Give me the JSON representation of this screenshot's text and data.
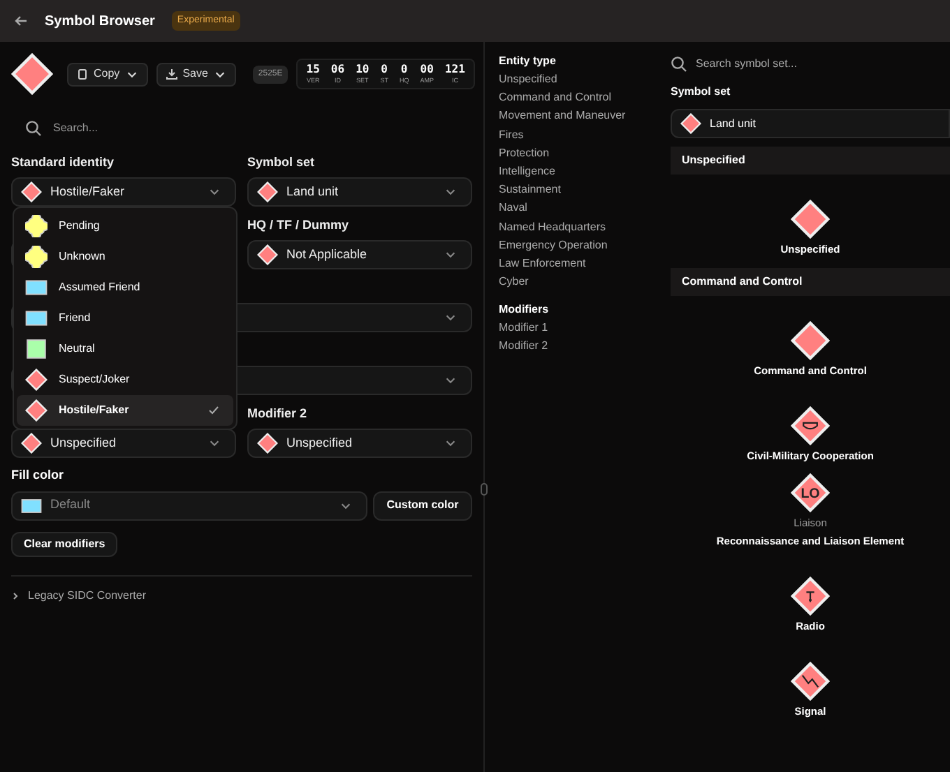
{
  "header": {
    "title": "Symbol Browser",
    "badge": "Experimental"
  },
  "toolbar": {
    "copy": "Copy",
    "save": "Save",
    "standard": "2525E",
    "code": [
      {
        "value": "15",
        "label": "VER"
      },
      {
        "value": "06",
        "label": "ID"
      },
      {
        "value": "10",
        "label": "SET"
      },
      {
        "value": "0",
        "label": "ST"
      },
      {
        "value": "0",
        "label": "HQ"
      },
      {
        "value": "00",
        "label": "AMP"
      },
      {
        "value": "121",
        "label": "IC"
      }
    ]
  },
  "search": {
    "placeholder": "Search..."
  },
  "form": [
    {
      "label": "Standard identity",
      "value": "Hostile/Faker"
    },
    {
      "label": "Symbol set",
      "value": "Land unit"
    },
    {
      "label": "HQ / TF / Dummy",
      "value": "Not Applicable"
    },
    {
      "value": "Unspecified"
    },
    {
      "label": "Modifier 2",
      "value": "Unspecified"
    }
  ],
  "fill_color": {
    "label": "Fill color",
    "value": "Default",
    "button": "Custom color"
  },
  "clear_button": "Clear modifiers",
  "legacy": {
    "label": "Legacy SIDC Converter",
    "expanded": false
  },
  "dropdown": [
    {
      "label": "Pending",
      "kind": "clover",
      "color": "#ffff80",
      "selected": false
    },
    {
      "label": "Unknown",
      "kind": "clover",
      "color": "#ffff80",
      "selected": false
    },
    {
      "label": "Assumed Friend",
      "kind": "rect",
      "color": "#80e0ff",
      "selected": false
    },
    {
      "label": "Friend",
      "kind": "rect",
      "color": "#80e0ff",
      "selected": false
    },
    {
      "label": "Neutral",
      "kind": "square",
      "color": "#aaffaa",
      "selected": false
    },
    {
      "label": "Suspect/Joker",
      "kind": "diamond",
      "color": "#ff8080",
      "selected": false
    },
    {
      "label": "Hostile/Faker",
      "kind": "diamond",
      "color": "#ff8080",
      "selected": true
    }
  ],
  "entity_types": {
    "heading": "Entity type",
    "items": [
      "Unspecified",
      "Command and Control",
      "Movement and Maneuver",
      "Fires",
      "Protection",
      "Intelligence",
      "Sustainment",
      "Naval",
      "Named Headquarters",
      "Emergency Operation",
      "Law Enforcement",
      "Cyber"
    ]
  },
  "modifiers": {
    "heading": "Modifiers",
    "items": [
      "Modifier 1",
      "Modifier 2"
    ]
  },
  "symbol_search": {
    "placeholder": "Search symbol set..."
  },
  "symbol_set": {
    "label": "Symbol set",
    "value": "Land unit"
  },
  "sections": [
    {
      "title": "Unspecified",
      "items": [
        {
          "name": "Unspecified",
          "kind": "plain"
        }
      ]
    },
    {
      "title": "Command and Control",
      "items": [
        {
          "name": "Command and Control",
          "kind": "plain"
        },
        {
          "name": "Civil-Military Cooperation",
          "kind": "cimic"
        },
        {
          "name": "Reconnaissance and Liaison Element",
          "sublabel": "Liaison",
          "kind": "text",
          "glyph_text": "LO"
        },
        {
          "name": "Radio",
          "kind": "radio"
        },
        {
          "name": "Signal",
          "kind": "signal"
        }
      ]
    }
  ]
}
